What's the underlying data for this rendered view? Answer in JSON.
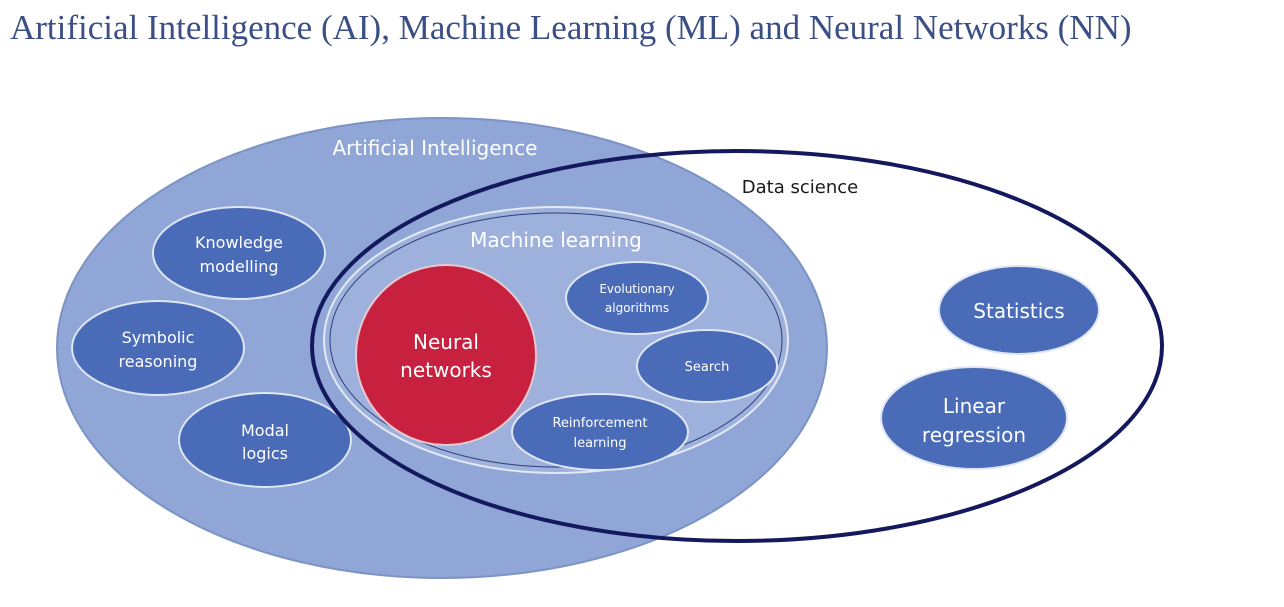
{
  "title": "Artificial Intelligence (AI), Machine Learning (ML) and Neural Networks (NN)",
  "colors": {
    "title_text": "#3b4f86",
    "ai_fill": "#8fa6d6",
    "ml_fill": "#9db1dc",
    "node_fill": "#4a6bb8",
    "neural_fill": "#c8213f",
    "data_science_stroke": "#14195e"
  },
  "regions": {
    "artificial_intelligence": "Artificial Intelligence",
    "machine_learning": "Machine learning",
    "data_science": "Data science"
  },
  "nodes": {
    "knowledge_modelling": [
      "Knowledge",
      "modelling"
    ],
    "symbolic_reasoning": [
      "Symbolic",
      "reasoning"
    ],
    "modal_logics": [
      "Modal",
      "logics"
    ],
    "neural_networks": [
      "Neural",
      "networks"
    ],
    "evolutionary_algorithms": [
      "Evolutionary",
      "algorithms"
    ],
    "search": "Search",
    "reinforcement_learning": [
      "Reinforcement",
      "learning"
    ],
    "statistics": "Statistics",
    "linear_regression": [
      "Linear",
      "regression"
    ]
  }
}
